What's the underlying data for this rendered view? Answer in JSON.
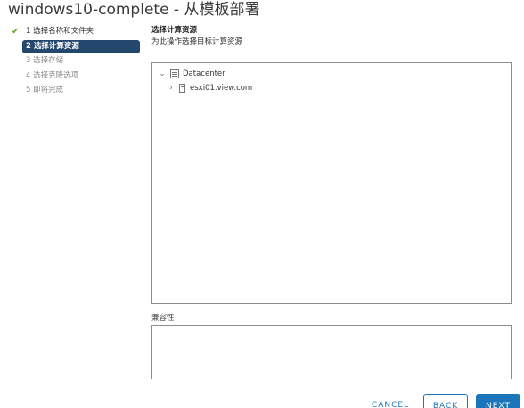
{
  "title": "windows10-complete - 从模板部署",
  "steps": [
    {
      "label": "1 选择名称和文件夹",
      "state": "done"
    },
    {
      "label": "2 选择计算资源",
      "state": "active"
    },
    {
      "label": "3 选择存储",
      "state": "pending"
    },
    {
      "label": "4 选择克隆选项",
      "state": "pending"
    },
    {
      "label": "5 即将完成",
      "state": "pending"
    }
  ],
  "section": {
    "title": "选择计算资源",
    "description": "为此操作选择目标计算资源"
  },
  "tree": {
    "datacenter": {
      "label": "Datacenter",
      "expanded": true
    },
    "host": {
      "label": "esxi01.view.com",
      "expanded": false
    }
  },
  "compatibility": {
    "label": "兼容性"
  },
  "buttons": {
    "cancel": "CANCEL",
    "back": "BACK",
    "next": "NEXT"
  },
  "colors": {
    "accent": "#1a75bb",
    "active_step": "#24476d",
    "check": "#62a420"
  }
}
